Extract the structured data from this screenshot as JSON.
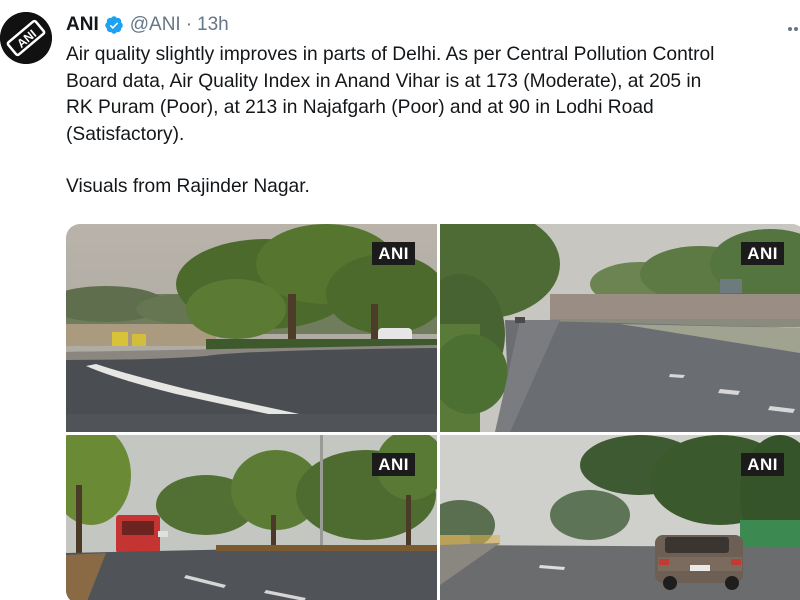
{
  "tweet": {
    "author_name": "ANI",
    "author_handle": "@ANI",
    "time_separator": "·",
    "time": "13h",
    "avatar_logo_text": "ANI",
    "verified": true,
    "text_lines": [
      "Air quality slightly improves in parts of Delhi. As per Central Pollution Control",
      "Board data, Air Quality Index in Anand Vihar is at 173 (Moderate), at 205 in",
      "RK Puram (Poor), at 213 in Najafgarh (Poor) and at 90 in Lodhi Road",
      "(Satisfactory).",
      "Visuals from Rajinder Nagar."
    ]
  },
  "media": {
    "watermark": "ANI",
    "photos": [
      {
        "name": "road-curve-with-trees"
      },
      {
        "name": "road-with-boundary-wall"
      },
      {
        "name": "road-with-red-bus"
      },
      {
        "name": "road-with-car"
      }
    ]
  },
  "icons": {
    "verified": "verified-badge-icon",
    "more": "more-options-icon"
  },
  "colors": {
    "text": "#14171a",
    "secondary": "#657786",
    "verified": "#1da1f2"
  }
}
